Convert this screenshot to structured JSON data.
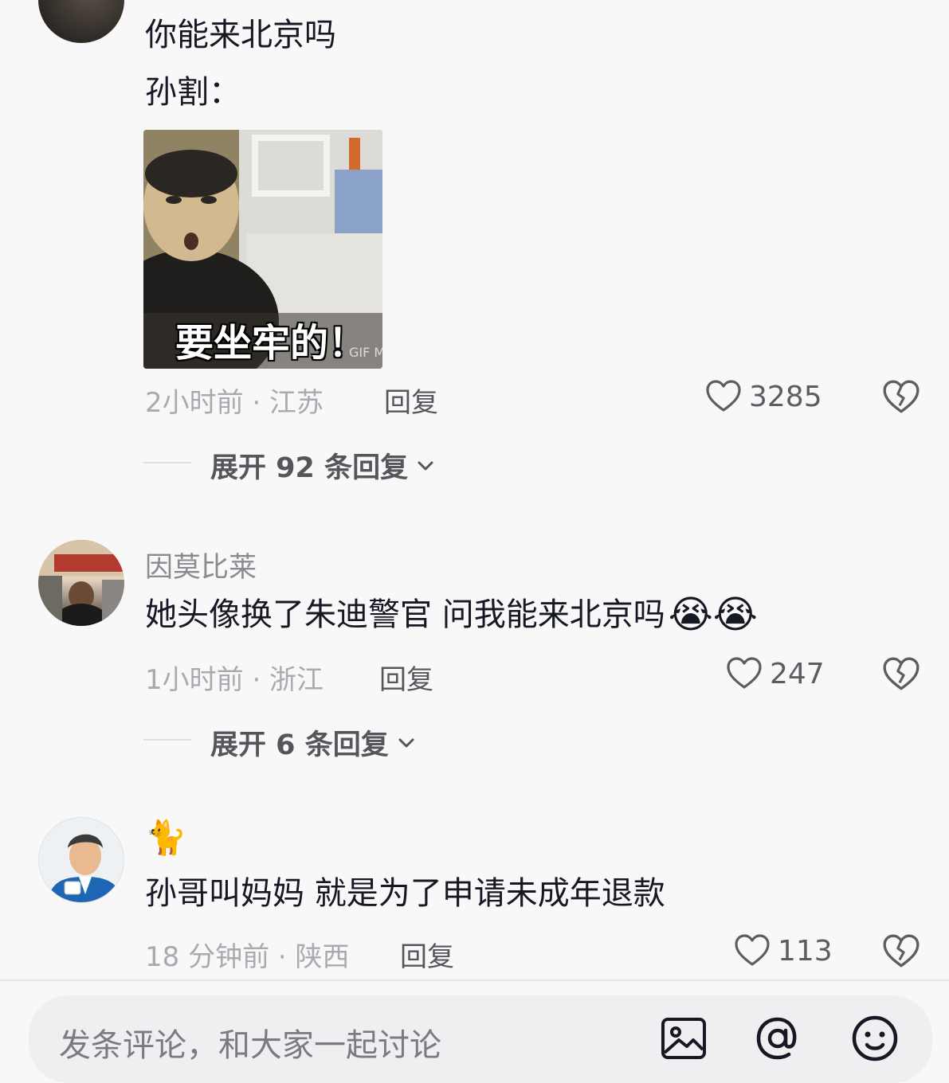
{
  "comments": [
    {
      "username": "",
      "lines": [
        "你能来北京吗",
        "孙割："
      ],
      "meme_caption": "要坐牢的！",
      "meme_watermark": "GIF Mas",
      "time_location": "2小时前 · 江苏",
      "reply_label": "回复",
      "likes": "3285",
      "expand_label": "展开 92 条回复"
    },
    {
      "username": "因莫比莱",
      "text": "她头像换了朱迪警官 问我能来北京吗",
      "emoji": "😭😭",
      "time_location": "1小时前 · 浙江",
      "reply_label": "回复",
      "likes": "247",
      "expand_label": "展开 6 条回复"
    },
    {
      "username": "🐈",
      "text": "孙哥叫妈妈 就是为了申请未成年退款",
      "time_location": "18 分钟前 · 陕西",
      "reply_label": "回复",
      "likes": "113"
    }
  ],
  "input_bar": {
    "placeholder": "发条评论，和大家一起讨论"
  },
  "colors": {
    "background": "#f8f8f8",
    "text": "#161823",
    "meta": "#a9aab0",
    "input_bg": "#efeff1"
  },
  "icons": [
    "heart-outline-icon",
    "broken-heart-icon",
    "chevron-down-icon",
    "image-icon",
    "at-icon",
    "smiley-icon"
  ]
}
